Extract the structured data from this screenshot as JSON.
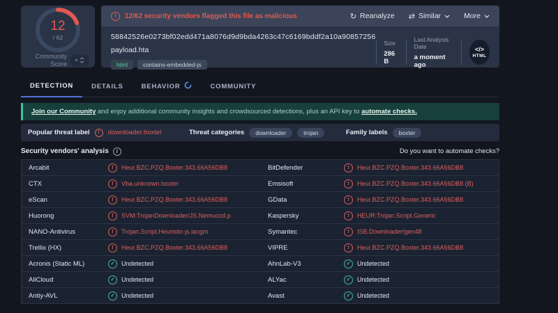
{
  "score": {
    "value": 12,
    "max": 62,
    "denominator": "/ 62",
    "label": "Community Score"
  },
  "header": {
    "alert": "12/62 security vendors flagged this file as malicious",
    "actions": {
      "reanalyze": "Reanalyze",
      "similar": "Similar",
      "more": "More",
      "reanalyze_glyph": "↻",
      "similar_glyph": "⇄"
    },
    "hash": "58842526e0273bf02edd471a8076d9d9bda4263c47c6169bddf2a10a90857256",
    "filename": "payload.hta",
    "tags": [
      "html",
      "contains-embedded-js"
    ],
    "size": {
      "label": "Size",
      "value": "286 B"
    },
    "last_analysis": {
      "label": "Last Analysis Date",
      "value": "a moment ago"
    },
    "filetype": {
      "glyph": "</>",
      "label": "HTML"
    }
  },
  "tabs": [
    {
      "label": "DETECTION",
      "active": true
    },
    {
      "label": "DETAILS",
      "active": false
    },
    {
      "label": "BEHAVIOR",
      "active": false,
      "spinner": true
    },
    {
      "label": "COMMUNITY",
      "active": false
    }
  ],
  "banner": {
    "link1": "Join our Community",
    "middle": " and enjoy additional community insights and crowdsourced detections, plus an API key to ",
    "link2": "automate checks."
  },
  "threat": {
    "popular_label": "Popular threat label",
    "popular_value": "downloader.boxter",
    "categories_label": "Threat categories",
    "categories": [
      "downloader",
      "trojan"
    ],
    "family_label": "Family labels",
    "families": [
      "boxter"
    ]
  },
  "vendors": {
    "title": "Security vendors' analysis",
    "automate_question": "Do you want to automate checks?",
    "rows": [
      [
        {
          "vendor": "Arcabit",
          "result": "Heur.BZC.PZQ.Boxter.343.66A56DB8",
          "status": "malicious"
        },
        {
          "vendor": "BitDefender",
          "result": "Heur.BZC.PZQ.Boxter.343.66A56DB8",
          "status": "malicious"
        }
      ],
      [
        {
          "vendor": "CTX",
          "result": "Vba.unknown.boxter",
          "status": "malicious"
        },
        {
          "vendor": "Emsisoft",
          "result": "Heur.BZC.PZQ.Boxter.343.66A56DB8 (B)",
          "status": "malicious"
        }
      ],
      [
        {
          "vendor": "eScan",
          "result": "Heur.BZC.PZQ.Boxter.343.66A56DB8",
          "status": "malicious"
        },
        {
          "vendor": "GData",
          "result": "Heur.BZC.PZQ.Boxter.343.66A56DB8",
          "status": "malicious"
        }
      ],
      [
        {
          "vendor": "Huorong",
          "result": "SVM:TrojanDownloader/JS.Nemucod.p",
          "status": "malicious"
        },
        {
          "vendor": "Kaspersky",
          "result": "HEUR:Trojan.Script.Generic",
          "status": "malicious"
        }
      ],
      [
        {
          "vendor": "NANO-Antivirus",
          "result": "Trojan.Script.Heuristic-js.iacgm",
          "status": "malicious"
        },
        {
          "vendor": "Symantec",
          "result": "ISB.Downloader!gen48",
          "status": "malicious"
        }
      ],
      [
        {
          "vendor": "Trellix (HX)",
          "result": "Heur.BZC.PZQ.Boxter.343.66A56DB8",
          "status": "malicious"
        },
        {
          "vendor": "VIPRE",
          "result": "Heur.BZC.PZQ.Boxter.343.66A56DB8",
          "status": "malicious"
        }
      ],
      [
        {
          "vendor": "Acronis (Static ML)",
          "result": "Undetected",
          "status": "undetected"
        },
        {
          "vendor": "AhnLab-V3",
          "result": "Undetected",
          "status": "undetected"
        }
      ],
      [
        {
          "vendor": "AliCloud",
          "result": "Undetected",
          "status": "undetected"
        },
        {
          "vendor": "ALYac",
          "result": "Undetected",
          "status": "undetected"
        }
      ],
      [
        {
          "vendor": "Antiy-AVL",
          "result": "Undetected",
          "status": "undetected"
        },
        {
          "vendor": "Avast",
          "result": "Undetected",
          "status": "undetected"
        }
      ]
    ]
  },
  "colors": {
    "accent_red": "#e2574e",
    "teal_ok": "#49b8a5",
    "tab_blue": "#5272d8",
    "banner_teal": "#3fc2aa"
  }
}
